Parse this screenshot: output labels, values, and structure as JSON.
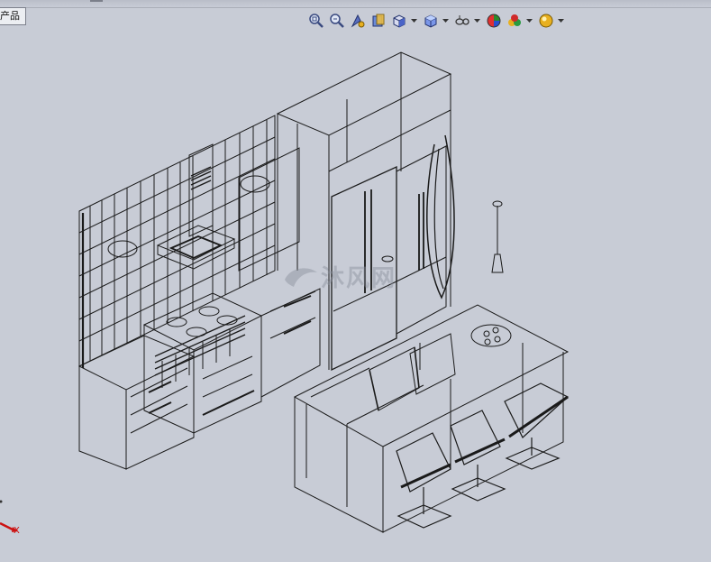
{
  "feature_tree_tab": {
    "label": "产品"
  },
  "view_toolbar": {
    "buttons": [
      {
        "name": "zoom-to-fit-icon",
        "dropdown": false
      },
      {
        "name": "zoom-to-area-icon",
        "dropdown": false
      },
      {
        "name": "previous-view-icon",
        "dropdown": false
      },
      {
        "name": "section-view-icon",
        "dropdown": false
      },
      {
        "name": "view-orientation-icon",
        "dropdown": true
      },
      {
        "name": "display-style-icon",
        "dropdown": true
      },
      {
        "name": "hide-show-items-icon",
        "dropdown": true
      },
      {
        "name": "edit-appearance-icon",
        "dropdown": false
      },
      {
        "name": "apply-scene-icon",
        "dropdown": true
      },
      {
        "name": "view-settings-icon",
        "dropdown": true
      }
    ]
  },
  "triad": {
    "axis_label": "X"
  },
  "watermark": {
    "text": "沐风网"
  },
  "colors": {
    "background": "#c8ccd6",
    "wireframe": "#1a1a1a",
    "axis_red": "#cc1111"
  }
}
